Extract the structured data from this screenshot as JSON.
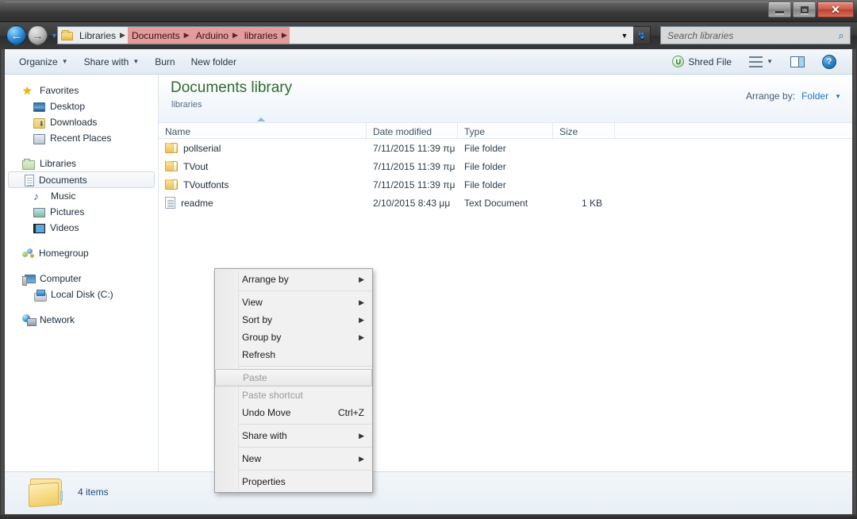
{
  "window": {
    "title": "",
    "controls": {
      "minimize": "Minimize",
      "maximize": "Restore",
      "close": "Close",
      "close_glyph": "✕"
    }
  },
  "addressbar": {
    "back_label": "Back",
    "back_glyph": "←",
    "forward_label": "Forward",
    "forward_glyph": "→",
    "history_caret": "▼",
    "refresh_glyph": "↯",
    "crumb_caret": "▼",
    "breadcrumbs": [
      {
        "label": "Libraries",
        "selected": false,
        "sep": "▶"
      },
      {
        "label": "Documents",
        "selected": true,
        "sep": "▶"
      },
      {
        "label": "Arduino",
        "selected": true,
        "sep": "▶"
      },
      {
        "label": "libraries",
        "selected": true,
        "sep": "▶"
      }
    ]
  },
  "search": {
    "placeholder": "Search libraries",
    "value": "",
    "icon_glyph": "⌕"
  },
  "toolbar": {
    "organize": "Organize",
    "share_with": "Share with",
    "burn": "Burn",
    "new_folder": "New folder",
    "shred_file": "Shred File",
    "shred_badge": "U",
    "caret": "▼",
    "help_glyph": "?"
  },
  "sidebar": {
    "groups": [
      {
        "header": {
          "label": "Favorites",
          "icon": "star-icon"
        },
        "items": [
          {
            "label": "Desktop",
            "icon": "desktop-icon",
            "selected": false
          },
          {
            "label": "Downloads",
            "icon": "downloads-icon",
            "selected": false
          },
          {
            "label": "Recent Places",
            "icon": "recent-places-icon",
            "selected": false
          }
        ]
      },
      {
        "header": {
          "label": "Libraries",
          "icon": "libraries-icon"
        },
        "items": [
          {
            "label": "Documents",
            "icon": "documents-icon",
            "selected": true
          },
          {
            "label": "Music",
            "icon": "music-icon",
            "selected": false
          },
          {
            "label": "Pictures",
            "icon": "pictures-icon",
            "selected": false
          },
          {
            "label": "Videos",
            "icon": "videos-icon",
            "selected": false
          }
        ]
      },
      {
        "header": {
          "label": "Homegroup",
          "icon": "homegroup-icon"
        },
        "items": []
      },
      {
        "header": {
          "label": "Computer",
          "icon": "computer-icon"
        },
        "items": [
          {
            "label": "Local Disk (C:)",
            "icon": "local-disk-icon",
            "selected": false
          }
        ]
      },
      {
        "header": {
          "label": "Network",
          "icon": "network-icon"
        },
        "items": []
      }
    ]
  },
  "content": {
    "library_title": "Documents library",
    "library_subtitle": "libraries",
    "arrange_label": "Arrange by:",
    "arrange_value": "Folder",
    "arrange_caret": "▼",
    "columns": [
      {
        "key": "name",
        "label": "Name",
        "sorted": true,
        "sort_direction": "asc"
      },
      {
        "key": "date",
        "label": "Date modified",
        "sorted": false
      },
      {
        "key": "type",
        "label": "Type",
        "sorted": false
      },
      {
        "key": "size",
        "label": "Size",
        "sorted": false
      }
    ],
    "rows": [
      {
        "name": "pollserial",
        "date": "7/11/2015 11:39 πμ",
        "type": "File folder",
        "size": "",
        "icon": "folder-icon"
      },
      {
        "name": "TVout",
        "date": "7/11/2015 11:39 πμ",
        "type": "File folder",
        "size": "",
        "icon": "folder-icon"
      },
      {
        "name": "TVoutfonts",
        "date": "7/11/2015 11:39 πμ",
        "type": "File folder",
        "size": "",
        "icon": "folder-icon"
      },
      {
        "name": "readme",
        "date": "2/10/2015 8:43 μμ",
        "type": "Text Document",
        "size": "1 KB",
        "icon": "text-document-icon"
      }
    ]
  },
  "statusbar": {
    "item_count": "4 items"
  },
  "context_menu": {
    "items": [
      {
        "label": "Arrange by",
        "submenu": true,
        "disabled": false,
        "accel": "",
        "hover": false,
        "separator_after": true
      },
      {
        "label": "View",
        "submenu": true,
        "disabled": false,
        "accel": "",
        "hover": false,
        "separator_after": false
      },
      {
        "label": "Sort by",
        "submenu": true,
        "disabled": false,
        "accel": "",
        "hover": false,
        "separator_after": false
      },
      {
        "label": "Group by",
        "submenu": true,
        "disabled": false,
        "accel": "",
        "hover": false,
        "separator_after": false
      },
      {
        "label": "Refresh",
        "submenu": false,
        "disabled": false,
        "accel": "",
        "hover": false,
        "separator_after": true
      },
      {
        "label": "Paste",
        "submenu": false,
        "disabled": true,
        "accel": "",
        "hover": true,
        "separator_after": false
      },
      {
        "label": "Paste shortcut",
        "submenu": false,
        "disabled": true,
        "accel": "",
        "hover": false,
        "separator_after": false
      },
      {
        "label": "Undo Move",
        "submenu": false,
        "disabled": false,
        "accel": "Ctrl+Z",
        "hover": false,
        "separator_after": true
      },
      {
        "label": "Share with",
        "submenu": true,
        "disabled": false,
        "accel": "",
        "hover": false,
        "separator_after": true
      },
      {
        "label": "New",
        "submenu": true,
        "disabled": false,
        "accel": "",
        "hover": false,
        "separator_after": true
      },
      {
        "label": "Properties",
        "submenu": false,
        "disabled": false,
        "accel": "",
        "hover": false,
        "separator_after": false
      }
    ],
    "submenu_arrow": "▶"
  },
  "colors": {
    "breadcrumb_highlight": "#e39b9b",
    "library_title": "#2e6b2e",
    "link_blue": "#1f6fd0",
    "close_button": "#cf5f4e"
  }
}
